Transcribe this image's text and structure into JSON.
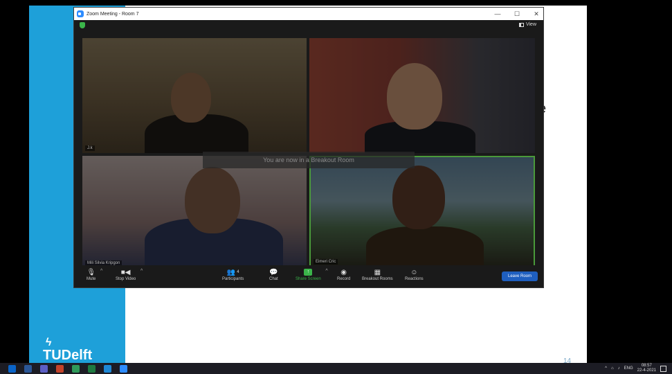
{
  "slide": {
    "logo_text": "TUDelft",
    "partial_text": "e",
    "page_number": "14"
  },
  "window": {
    "title": "Zoom Meeting - Room 7",
    "controls": {
      "minimize": "—",
      "maximize": "☐",
      "close": "✕"
    }
  },
  "topbar": {
    "view_label": "View"
  },
  "tiles": [
    {
      "name": "J.k"
    },
    {
      "name": ""
    },
    {
      "name": "Mili Silvia Kripgon"
    },
    {
      "name": "Eimeri Cric"
    }
  ],
  "breakout_message": "You are now in a Breakout Room",
  "toolbar": {
    "mute": "Mute",
    "stop_video": "Stop Video",
    "participants": "Participants",
    "participants_count": "4",
    "chat": "Chat",
    "share_screen": "Share Screen",
    "record": "Record",
    "breakout_rooms": "Breakout Rooms",
    "reactions": "Reactions",
    "leave_room": "Leave Room"
  },
  "taskbar": {
    "apps": [
      "outlook-icon",
      "word-icon",
      "teams-icon",
      "powerpoint-icon",
      "file-icon",
      "excel-icon",
      "edge-icon",
      "zoom-icon"
    ],
    "app_colors": [
      "#0a64c8",
      "#2b5797",
      "#5c5fc4",
      "#c4432a",
      "#2f9a5a",
      "#1e7a40",
      "#1e88d6",
      "#2d8cff"
    ],
    "language": "ENG",
    "time": "08:57",
    "date": "22-4-2021"
  }
}
